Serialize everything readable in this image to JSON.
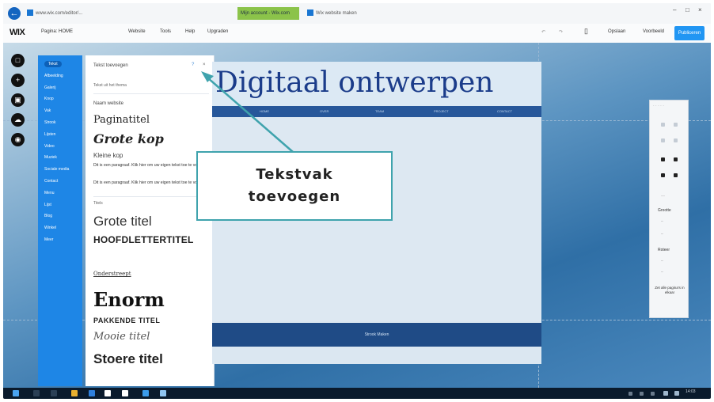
{
  "browser": {
    "tab_title": "www.wix.com/editor/...",
    "tab2": "Mijn account - Wix.com",
    "tab3": "Wix website maken",
    "window_controls": [
      "–",
      "□",
      "×"
    ]
  },
  "wix_bar": {
    "logo": "WIX",
    "page_label": "Pagina: HOME",
    "menu": [
      "Website",
      "Tools",
      "Help",
      "Upgraden"
    ],
    "right": [
      "Opslaan",
      "Voorbeeld"
    ],
    "publish": "Publiceren"
  },
  "left_rail": {
    "icons": [
      "menu-icon",
      "add-icon",
      "media-icon",
      "upload-icon",
      "app-icon"
    ]
  },
  "categories": [
    "Tekst",
    "Afbeelding",
    "Galerij",
    "Knop",
    "Vak",
    "Strook",
    "Lijsten",
    "Video",
    "Muziek",
    "Sociale media",
    "Contact",
    "Menu",
    "Lijst",
    "Blog",
    "Winkel",
    "Meer"
  ],
  "text_panel": {
    "title": "Tekst toevoegen",
    "theme_label": "Tekst uit het thema",
    "site_title_preview": "Naam website",
    "page_title": "Paginatitel",
    "big_heading": "Grote kop",
    "small_heading": "Kleine kop",
    "paragraph1": "Dit is een paragraaf. Klik hier om uw eigen tekst toe te voegen.",
    "paragraph2": "Dit is een paragraaf. Klik hier om uw eigen tekst toe te voegen.",
    "titles_label": "Titels",
    "t_grote": "Grote titel",
    "t_hoofd": "HOOFDLETTERTITEL",
    "t_onder": "Onderstreept",
    "t_enorm": "Enorm",
    "t_pakkend": "PAKKENDE TITEL",
    "t_mooi": "Mooie titel",
    "t_stoer": "Stoere titel"
  },
  "page": {
    "title": "Digitaal ontwerpen",
    "nav": [
      "HOME",
      "OVER",
      "TEAM",
      "PROJECT",
      "CONTACT"
    ],
    "footer": "Strook Maken"
  },
  "tool_panel": {
    "labels": [
      "Grootte",
      "Roteer",
      "Zet alle pagina's in elkaar"
    ]
  },
  "annotation": {
    "line1": "Tekstvak",
    "line2": "toevoegen"
  },
  "taskbar": {
    "clock": "14:03"
  }
}
